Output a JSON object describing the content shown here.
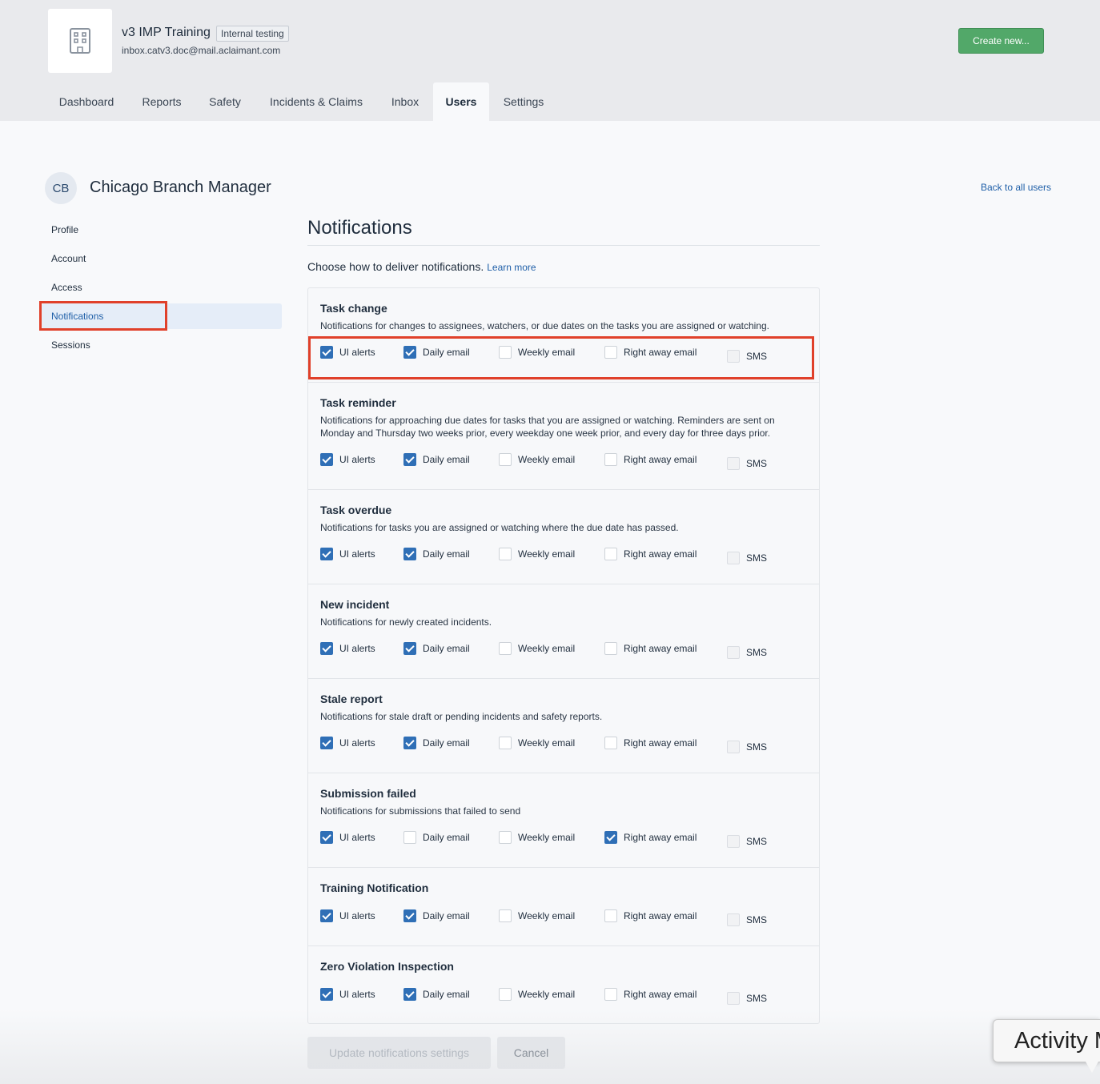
{
  "org": {
    "name": "v3 IMP Training",
    "badge": "Internal testing",
    "email": "inbox.catv3.doc@mail.aclaimant.com",
    "logo_icon": "building-icon"
  },
  "header": {
    "create_label": "Create new..."
  },
  "nav": {
    "tabs": [
      {
        "label": "Dashboard"
      },
      {
        "label": "Reports"
      },
      {
        "label": "Safety"
      },
      {
        "label": "Incidents & Claims"
      },
      {
        "label": "Inbox"
      },
      {
        "label": "Users"
      },
      {
        "label": "Settings"
      }
    ],
    "active": "Users"
  },
  "user": {
    "initials": "CB",
    "name": "Chicago Branch Manager",
    "back_label": "Back to all users"
  },
  "sidebar": {
    "items": [
      {
        "label": "Profile"
      },
      {
        "label": "Account"
      },
      {
        "label": "Access"
      },
      {
        "label": "Notifications"
      },
      {
        "label": "Sessions"
      }
    ],
    "active": "Notifications"
  },
  "notifications": {
    "title": "Notifications",
    "intro": "Choose how to deliver notifications.",
    "learn_more": "Learn more",
    "option_labels": {
      "ui": "UI alerts",
      "daily": "Daily email",
      "weekly": "Weekly email",
      "right": "Right away email",
      "sms": "SMS"
    },
    "groups": [
      {
        "title": "Task change",
        "desc": "Notifications for changes to assignees, watchers, or due dates on the tasks you are assigned or watching.",
        "ui": true,
        "daily": true,
        "weekly": false,
        "right": false,
        "sms": false
      },
      {
        "title": "Task reminder",
        "desc": "Notifications for approaching due dates for tasks that you are assigned or watching. Reminders are sent on Monday and Thursday two weeks prior, every weekday one week prior, and every day for three days prior.",
        "ui": true,
        "daily": true,
        "weekly": false,
        "right": false,
        "sms": false
      },
      {
        "title": "Task overdue",
        "desc": "Notifications for tasks you are assigned or watching where the due date has passed.",
        "ui": true,
        "daily": true,
        "weekly": false,
        "right": false,
        "sms": false
      },
      {
        "title": "New incident",
        "desc": "Notifications for newly created incidents.",
        "ui": true,
        "daily": true,
        "weekly": false,
        "right": false,
        "sms": false
      },
      {
        "title": "Stale report",
        "desc": "Notifications for stale draft or pending incidents and safety reports.",
        "ui": true,
        "daily": true,
        "weekly": false,
        "right": false,
        "sms": false
      },
      {
        "title": "Submission failed",
        "desc": "Notifications for submissions that failed to send",
        "ui": true,
        "daily": false,
        "weekly": false,
        "right": true,
        "sms": false
      },
      {
        "title": "Training Notification",
        "desc": "",
        "ui": true,
        "daily": true,
        "weekly": false,
        "right": false,
        "sms": false
      },
      {
        "title": "Zero Violation Inspection",
        "desc": "",
        "ui": true,
        "daily": true,
        "weekly": false,
        "right": false,
        "sms": false
      }
    ],
    "update_label": "Update notifications settings",
    "cancel_label": "Cancel"
  },
  "activity": {
    "label": "Activity M"
  }
}
